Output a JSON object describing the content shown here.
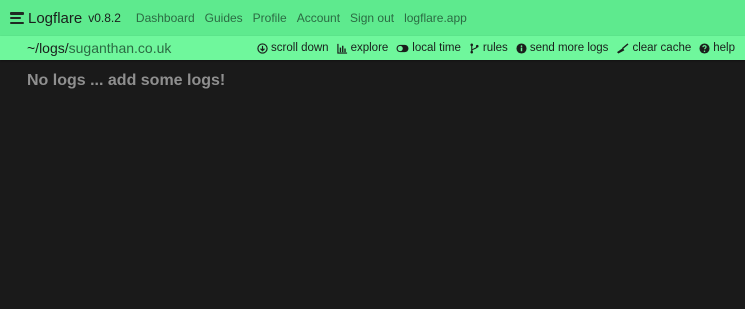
{
  "header": {
    "brand": "Logflare",
    "version": "v0.8.2",
    "nav": [
      "Dashboard",
      "Guides",
      "Profile",
      "Account",
      "Sign out",
      "logflare.app"
    ]
  },
  "subheader": {
    "path_prefix": "~/logs/",
    "source_name": "suganthan.co.uk",
    "actions": {
      "scroll_down": "scroll down",
      "explore": "explore",
      "local_time": "local time",
      "rules": "rules",
      "send_more_logs": "send more logs",
      "clear_cache": "clear cache",
      "help": "help"
    }
  },
  "main": {
    "empty_message": "No logs ... add some logs!"
  },
  "colors": {
    "nav_bg": "#5eea8e",
    "subnav_bg": "#6ff79c",
    "body_bg": "#1a1a1a",
    "link": "#2c6b43",
    "muted_text": "#8f8f8f"
  }
}
